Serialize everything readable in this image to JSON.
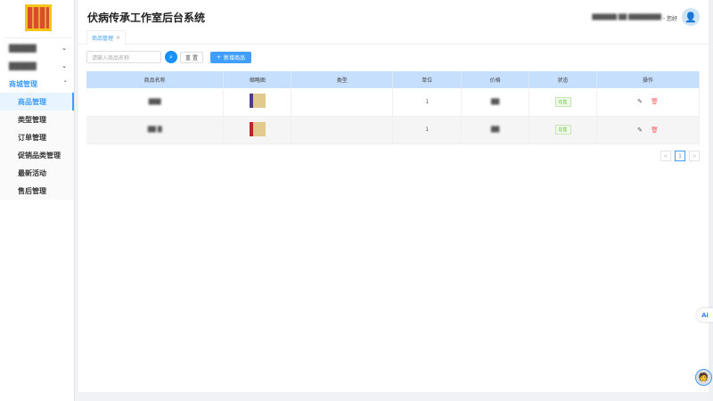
{
  "app": {
    "title": "伏病传承工作室后台系统",
    "greeting": "您好",
    "user_name": "██████ ██ ████████"
  },
  "sidebar": {
    "items": [
      {
        "label": "█████",
        "expanded": false
      },
      {
        "label": "█████",
        "expanded": false
      },
      {
        "label": "商城管理",
        "expanded": true,
        "children": [
          "商品管理",
          "类型管理",
          "订单管理",
          "促销品类管理",
          "最新活动",
          "售后管理"
        ]
      }
    ]
  },
  "tabs": [
    {
      "label": "商品管理",
      "close": "×"
    }
  ],
  "toolbar": {
    "search_placeholder": "请输入商品名称",
    "reset_label": "重 置",
    "add_label": "新增商品",
    "add_icon": "+"
  },
  "table": {
    "headers": [
      "商品名称",
      "缩略图",
      "类型",
      "单位",
      "价格",
      "状态",
      "操作"
    ],
    "rows": [
      {
        "name": "███",
        "type": "",
        "unit": "1",
        "price": "██",
        "status": "在售"
      },
      {
        "name": "██ █",
        "type": "",
        "unit": "1",
        "price": "██",
        "status": "在售"
      }
    ]
  },
  "pagination": {
    "prev": "<",
    "current": "1",
    "next": ">"
  },
  "floating": {
    "ai_label": "Ai"
  }
}
